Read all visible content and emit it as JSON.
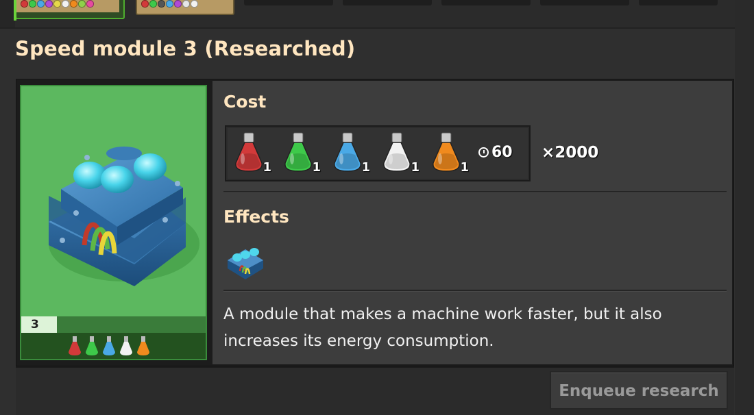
{
  "technology": {
    "title": "Speed module 3 (Researched)",
    "level": "3"
  },
  "cost": {
    "header": "Cost",
    "ingredients": [
      {
        "name": "automation-science-pack",
        "color": "#d23a3a",
        "count": "1"
      },
      {
        "name": "logistic-science-pack",
        "color": "#3ec94a",
        "count": "1"
      },
      {
        "name": "chemical-science-pack",
        "color": "#4aa9e6",
        "count": "1"
      },
      {
        "name": "utility-science-pack",
        "color": "#f2f2f2",
        "count": "1"
      },
      {
        "name": "production-science-pack",
        "color": "#f08a1e",
        "count": "1"
      }
    ],
    "time": "60",
    "multiplier": "×2000"
  },
  "effects": {
    "header": "Effects",
    "icon": "speed-module-3-icon"
  },
  "description": "A module that makes a machine work faster, but it also increases its energy consumption.",
  "actions": {
    "enqueue_label": "Enqueue research"
  },
  "colors": {
    "title": "#ffe6c0",
    "card_bg": "#5cb85f",
    "researched_green": "#4fae2e"
  }
}
